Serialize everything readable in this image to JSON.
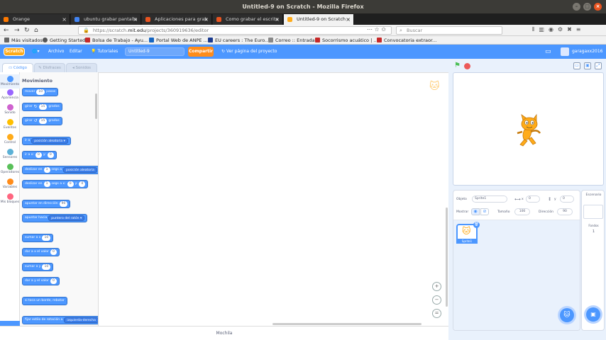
{
  "window": {
    "title": "Untitled-9 on Scratch - Mozilla Firefox"
  },
  "tabs": [
    {
      "label": "Orange",
      "color": "#ff7900"
    },
    {
      "label": "ubuntu grabar pantalla",
      "color": "#4285f4"
    },
    {
      "label": "Aplicaciones para grab",
      "color": "#e95420"
    },
    {
      "label": "Como grabar el escrito",
      "color": "#e95420"
    },
    {
      "label": "Untitled-9 on Scratch",
      "color": "#ffab19"
    }
  ],
  "nav": {
    "url_prefix": "https://scratch.",
    "url_domain": "mit.edu",
    "url_path": "/projects/360919636/editor",
    "search_placeholder": "Buscar"
  },
  "bookmarks": [
    {
      "label": "Más visitados",
      "color": "#666666"
    },
    {
      "label": "Getting Started",
      "color": "#555555"
    },
    {
      "label": "Bolsa de Trabajo - Ayu...",
      "color": "#c62828"
    },
    {
      "label": "Portal Web de ANPE ...",
      "color": "#1565c0"
    },
    {
      "label": "EU careers : The Euro...",
      "color": "#1a3a8f"
    },
    {
      "label": "Correo :: Entrada",
      "color": "#888888"
    },
    {
      "label": "Socorrismo acuático | ...",
      "color": "#c62828"
    },
    {
      "label": "Convocatoria extraor...",
      "color": "#c62828"
    }
  ],
  "scratch_menu": {
    "logo": "Scratch",
    "file": "Archivo",
    "edit": "Editar",
    "tutorials": "Tutoriales",
    "project_title": "Untitled-9",
    "share": "Compartir",
    "see_project": "Ver página del proyecto",
    "username": "garagaxx2016"
  },
  "editor_tabs": {
    "code": "Código",
    "costumes": "Disfraces",
    "sounds": "Sonidos"
  },
  "categories": [
    {
      "label": "Movimiento",
      "color": "#4c97ff"
    },
    {
      "label": "Apariencia",
      "color": "#9966ff"
    },
    {
      "label": "Sonido",
      "color": "#cf63cf"
    },
    {
      "label": "Eventos",
      "color": "#ffbf00"
    },
    {
      "label": "Control",
      "color": "#ffab19"
    },
    {
      "label": "Sensores",
      "color": "#5cb1d6"
    },
    {
      "label": "Operadores",
      "color": "#59c059"
    },
    {
      "label": "Variables",
      "color": "#ff8c1a"
    },
    {
      "label": "Mis bloques",
      "color": "#ff6680"
    }
  ],
  "palette": {
    "title": "Movimiento",
    "move": {
      "a": "mover",
      "n": "10",
      "b": "pasos"
    },
    "turn_right": {
      "a": "girar",
      "n": "15",
      "b": "grados"
    },
    "turn_left": {
      "a": "girar",
      "n": "15",
      "b": "grados"
    },
    "goto": {
      "a": "ir a",
      "dd": "posición aleatoria"
    },
    "goto_xy": {
      "a": "ir a x:",
      "x": "0",
      "b": "y:",
      "y": "0"
    },
    "glide_to": {
      "a": "deslizar en",
      "n": "1",
      "b": "segs a",
      "dd": "posición aleatoria"
    },
    "glide_xy": {
      "a": "deslizar en",
      "n": "1",
      "b": "segs a x:",
      "x": "0",
      "c": "y:",
      "y": "0"
    },
    "point_dir": {
      "a": "apuntar en dirección",
      "n": "90"
    },
    "point_towards": {
      "a": "apuntar hacia",
      "dd": "puntero del ratón"
    },
    "change_x": {
      "a": "sumar a x",
      "n": "10"
    },
    "set_x": {
      "a": "dar a x el valor",
      "n": "0"
    },
    "change_y": {
      "a": "sumar a y",
      "n": "10"
    },
    "set_y": {
      "a": "dar a y el valor",
      "n": "0"
    },
    "bounce": {
      "a": "si toca un borde, rebotar"
    },
    "rotation": {
      "a": "fijar estilo de rotación a",
      "dd": "izquierda-derecha"
    }
  },
  "workspace": {
    "zoom_in": "+",
    "zoom_out": "−",
    "zoom_reset": "="
  },
  "backpack": "Mochila",
  "sprite_info": {
    "sprite_label": "Objeto",
    "sprite_name": "Sprite1",
    "x_value": "0",
    "y_value": "0",
    "show_label": "Mostrar",
    "size_label": "Tamaño",
    "size_value": "100",
    "direction_label": "Dirección",
    "direction_value": "90"
  },
  "sprites": [
    {
      "name": "Sprite1"
    }
  ],
  "stage_panel": {
    "header": "Escenario",
    "backdrops_label": "Fondos",
    "backdrops_count": "1"
  },
  "colors": {
    "scratch_blue": "#4c97ff",
    "share_orange": "#ff8c1a",
    "firefox_tab_active": "#f2f2f2"
  }
}
